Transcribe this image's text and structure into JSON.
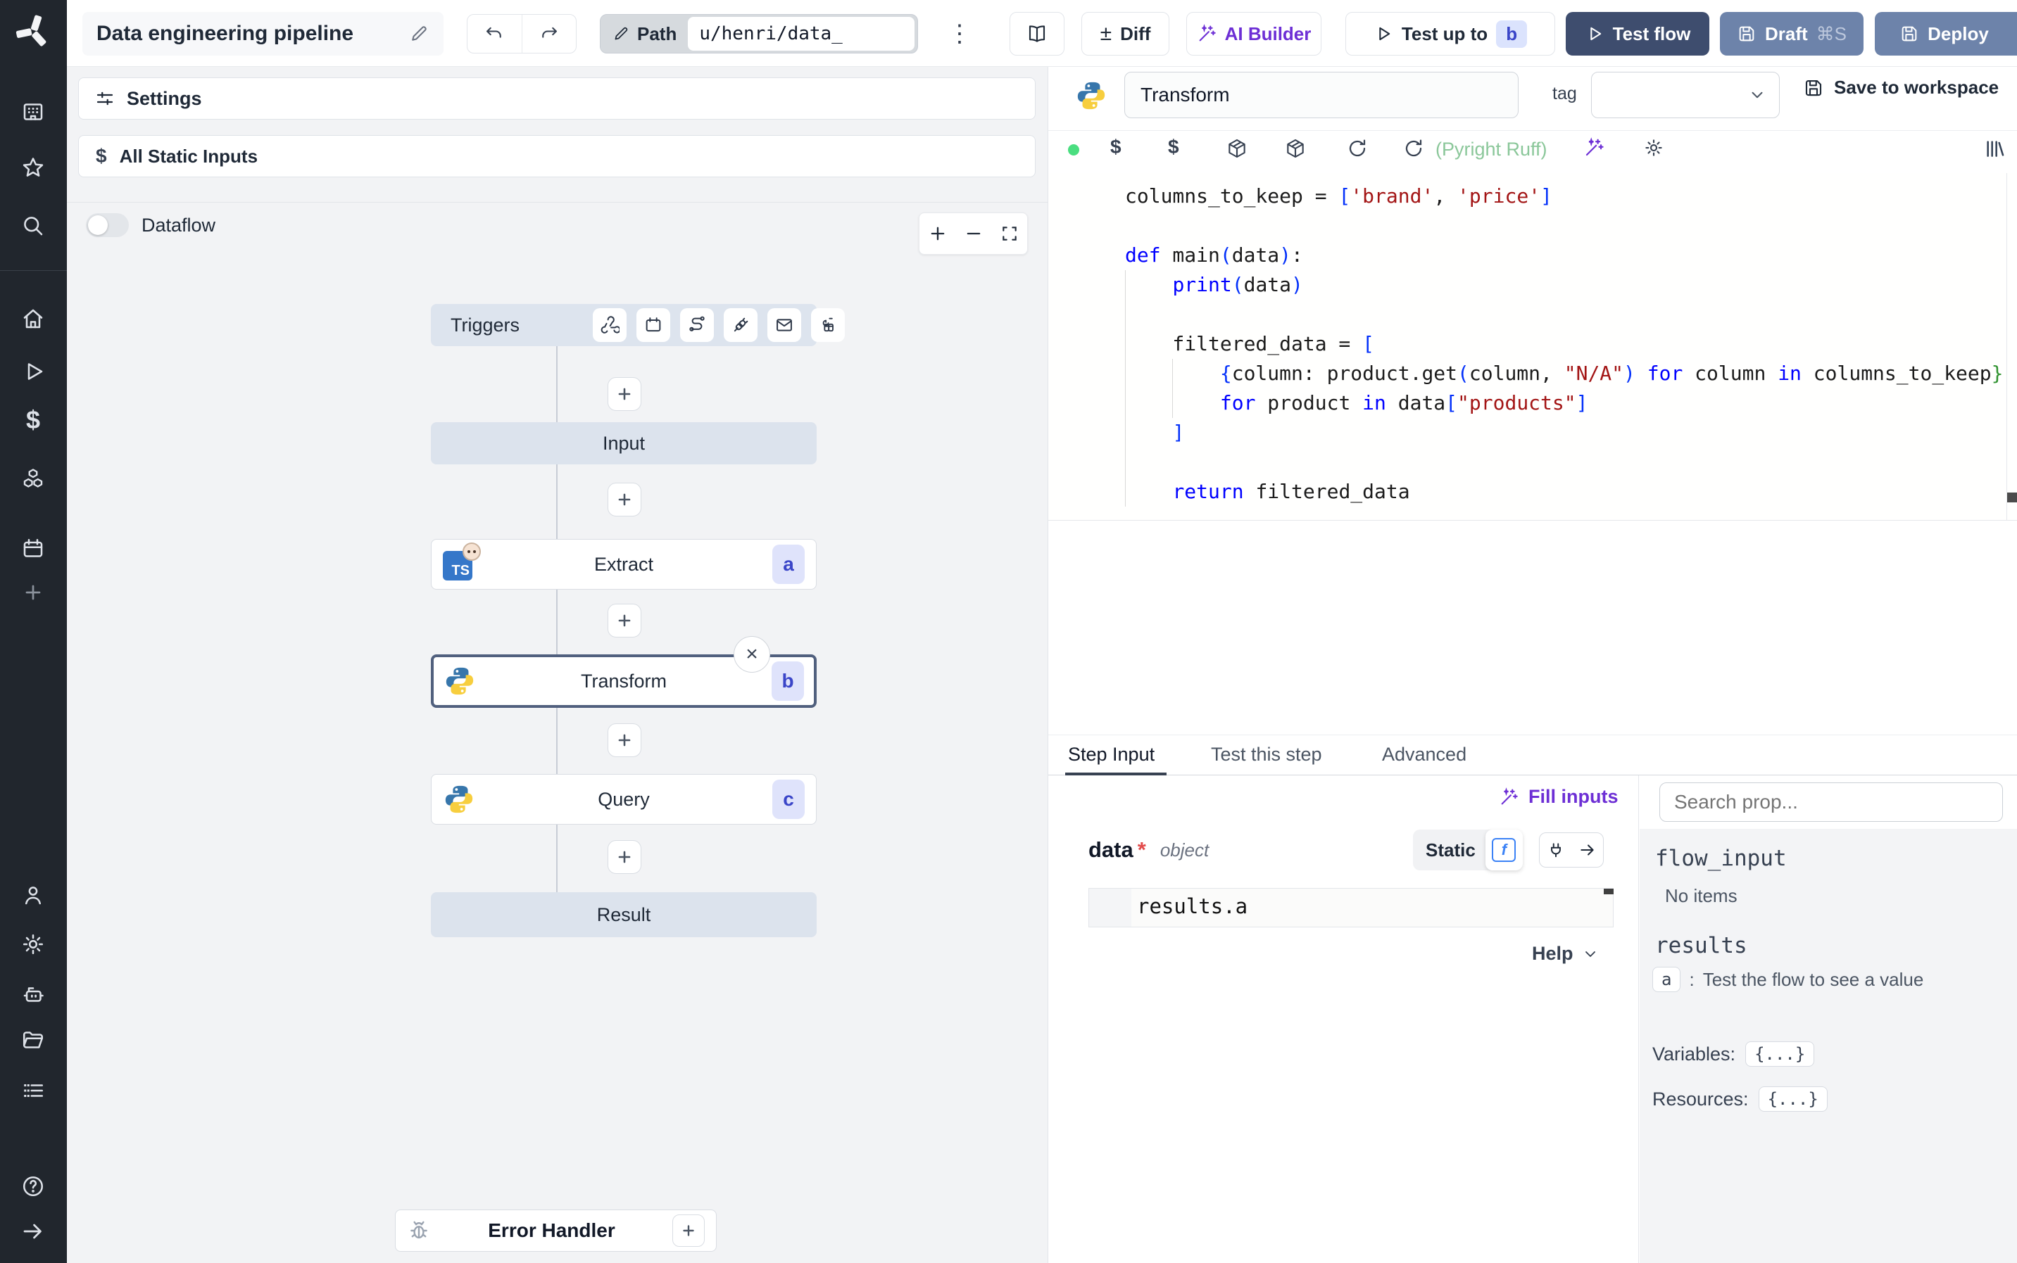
{
  "topbar": {
    "title": "Data engineering pipeline",
    "path_label": "Path",
    "path_value": "u/henri/data_",
    "menu_glyph": "⋮",
    "diff_label": "Diff",
    "ai_builder_label": "AI Builder",
    "test_up_to_label": "Test up to",
    "test_up_to_badge": "b",
    "test_flow_label": "Test flow",
    "draft_label": "Draft",
    "draft_shortcut": "⌘S",
    "deploy_label": "Deploy"
  },
  "flow_panel": {
    "settings_label": "Settings",
    "static_inputs_label": "All Static Inputs",
    "dataflow_label": "Dataflow",
    "triggers_label": "Triggers",
    "nodes": {
      "input": "Input",
      "extract": {
        "label": "Extract",
        "badge": "a",
        "language": "bun-typescript"
      },
      "transform": {
        "label": "Transform",
        "badge": "b",
        "language": "python"
      },
      "query": {
        "label": "Query",
        "badge": "c",
        "language": "python"
      },
      "result": "Result",
      "error_handler": "Error Handler"
    }
  },
  "editor": {
    "step_name": "Transform",
    "tag_label": "tag",
    "save_label": "Save to workspace",
    "lint_status": "(Pyright Ruff)",
    "code": {
      "language": "python",
      "lines": [
        [
          [
            "columns_to_keep = ",
            "d"
          ],
          [
            "[",
            "b"
          ],
          [
            "'brand'",
            "s"
          ],
          [
            ", ",
            "d"
          ],
          [
            "'price'",
            "s"
          ],
          [
            "]",
            "b"
          ]
        ],
        [],
        [
          [
            "def",
            "k"
          ],
          [
            " main",
            "d"
          ],
          [
            "(",
            "b"
          ],
          [
            "data",
            "d"
          ],
          [
            ")",
            "b"
          ],
          [
            ":",
            "d"
          ]
        ],
        [
          [
            "    ",
            "d"
          ],
          [
            "print",
            "k"
          ],
          [
            "(",
            "b"
          ],
          [
            "data",
            "d"
          ],
          [
            ")",
            "b"
          ]
        ],
        [],
        [
          [
            "    filtered_data = ",
            "d"
          ],
          [
            "[",
            "b"
          ]
        ],
        [
          [
            "        ",
            "d"
          ],
          [
            "{",
            "b"
          ],
          [
            "column: product.get",
            "d"
          ],
          [
            "(",
            "b"
          ],
          [
            "column, ",
            "d"
          ],
          [
            "\"N/A\"",
            "s"
          ],
          [
            ")",
            "b"
          ],
          [
            " ",
            "d"
          ],
          [
            "for",
            "k"
          ],
          [
            " column ",
            "d"
          ],
          [
            "in",
            "k"
          ],
          [
            " columns_to_keep",
            "d"
          ],
          [
            "}",
            "g"
          ]
        ],
        [
          [
            "        ",
            "d"
          ],
          [
            "for",
            "k"
          ],
          [
            " product ",
            "d"
          ],
          [
            "in",
            "k"
          ],
          [
            " data",
            "d"
          ],
          [
            "[",
            "b"
          ],
          [
            "\"products\"",
            "s"
          ],
          [
            "]",
            "b"
          ]
        ],
        [
          [
            "    ",
            "d"
          ],
          [
            "]",
            "b"
          ]
        ],
        [],
        [
          [
            "    ",
            "d"
          ],
          [
            "return",
            "k"
          ],
          [
            " filtered_data",
            "d"
          ]
        ]
      ]
    }
  },
  "tabs": {
    "step_input": "Step Input",
    "test_this_step": "Test this step",
    "advanced": "Advanced"
  },
  "step_input": {
    "fill_inputs_label": "Fill inputs",
    "field_name": "data",
    "required_marker": "*",
    "field_type": "object",
    "static_label": "Static",
    "expression": "results.a",
    "help_label": "Help"
  },
  "props_panel": {
    "search_placeholder": "Search prop...",
    "flow_input_label": "flow_input",
    "flow_input_empty": "No items",
    "results_label": "results",
    "result_key": "a",
    "result_separator": ":",
    "result_hint": "Test the flow to see a value",
    "variables_label": "Variables:",
    "variables_value": "{...}",
    "resources_label": "Resources:",
    "resources_value": "{...}"
  },
  "icons": {
    "dollar": "$",
    "kebab": "⋮",
    "plus_minus": "±",
    "help": "?",
    "close": "×"
  }
}
